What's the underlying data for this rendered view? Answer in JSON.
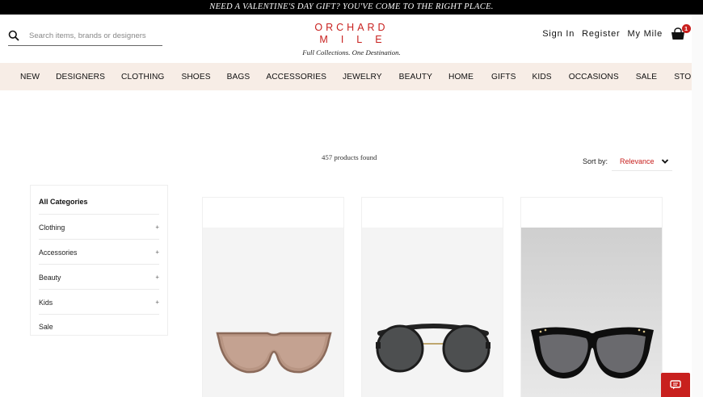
{
  "promo": {
    "text": "NEED A VALENTINE'S DAY GIFT? YOU'VE COME TO THE RIGHT PLACE."
  },
  "search": {
    "placeholder": "Search items, brands or designers",
    "icon": "search-icon"
  },
  "logo": {
    "line1": "ORCHARD",
    "line2": "MILE",
    "tagline": "Full Collections. One Destination."
  },
  "account": {
    "sign_in": "Sign In",
    "register": "Register",
    "my_mile": "My Mile",
    "cart_count": "1"
  },
  "nav": [
    "NEW",
    "DESIGNERS",
    "CLOTHING",
    "SHOES",
    "BAGS",
    "ACCESSORIES",
    "JEWELRY",
    "BEAUTY",
    "HOME",
    "GIFTS",
    "KIDS",
    "OCCASIONS",
    "SALE",
    "STORIES"
  ],
  "results": {
    "count_text": "457 products found"
  },
  "sort": {
    "label": "Sort by:",
    "value": "Relevance"
  },
  "sidebar": {
    "title": "All Categories",
    "items": [
      {
        "label": "Clothing",
        "expand": "+"
      },
      {
        "label": "Accessories",
        "expand": "+"
      },
      {
        "label": "Beauty",
        "expand": "+"
      },
      {
        "label": "Kids",
        "expand": "+"
      },
      {
        "label": "Sale"
      }
    ]
  },
  "products": [
    {
      "name": "tinted-shield-sunglasses"
    },
    {
      "name": "round-brow-bar-sunglasses"
    },
    {
      "name": "studded-cat-eye-sunglasses"
    }
  ],
  "colors": {
    "accent": "#c8201e",
    "nav_bg": "#f7ede6",
    "promo_bg": "#000000"
  }
}
